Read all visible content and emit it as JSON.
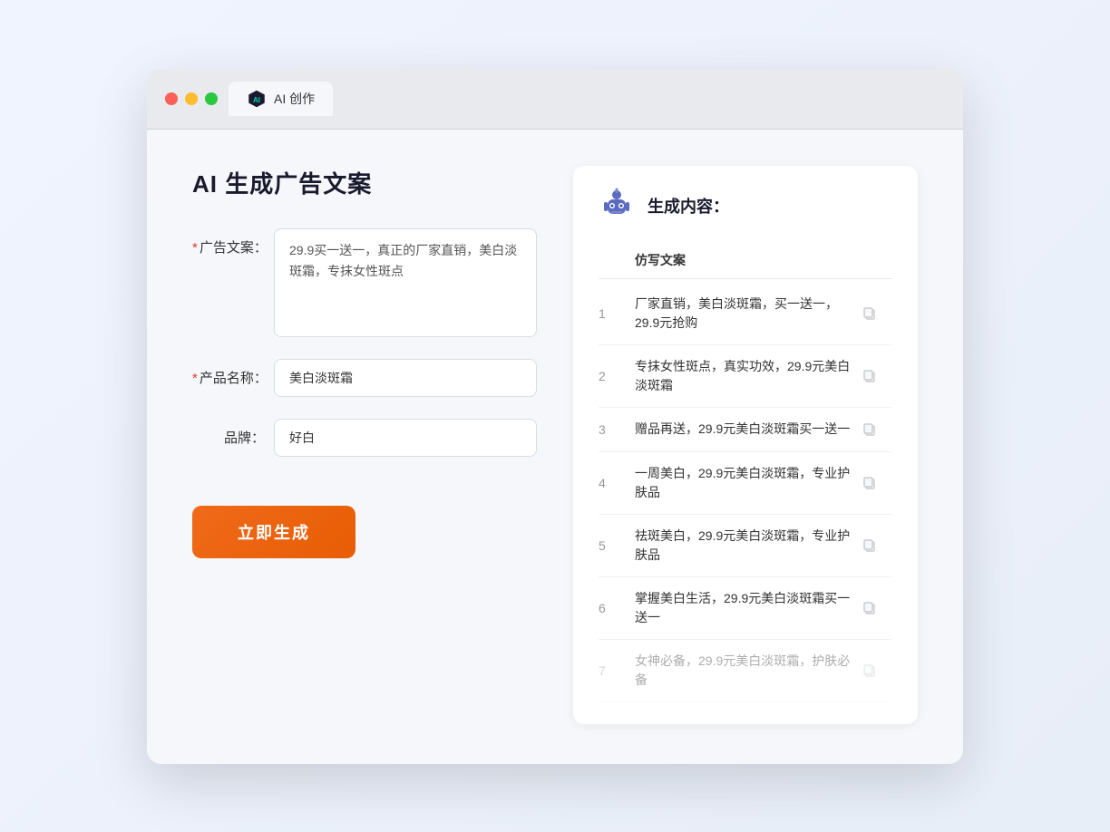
{
  "window": {
    "tab_label": "AI 创作"
  },
  "left_panel": {
    "title": "AI 生成广告文案",
    "form": {
      "ad_copy_label": "广告文案：",
      "ad_copy_required": "*",
      "ad_copy_value": "29.9买一送一，真正的厂家直销，美白淡斑霜，专抹女性斑点",
      "product_name_label": "产品名称：",
      "product_name_required": "*",
      "product_name_value": "美白淡斑霜",
      "brand_label": "品牌：",
      "brand_value": "好白"
    },
    "generate_btn": "立即生成"
  },
  "right_panel": {
    "title": "生成内容：",
    "table_header": "仿写文案",
    "results": [
      {
        "num": "1",
        "text": "厂家直销，美白淡斑霜，买一送一，29.9元抢购",
        "faded": false
      },
      {
        "num": "2",
        "text": "专抹女性斑点，真实功效，29.9元美白淡斑霜",
        "faded": false
      },
      {
        "num": "3",
        "text": "赠品再送，29.9元美白淡斑霜买一送一",
        "faded": false
      },
      {
        "num": "4",
        "text": "一周美白，29.9元美白淡斑霜，专业护肤品",
        "faded": false
      },
      {
        "num": "5",
        "text": "祛斑美白，29.9元美白淡斑霜，专业护肤品",
        "faded": false
      },
      {
        "num": "6",
        "text": "掌握美白生活，29.9元美白淡斑霜买一送一",
        "faded": false
      },
      {
        "num": "7",
        "text": "女神必备，29.9元美白淡斑霜，护肤必备",
        "faded": true
      }
    ]
  }
}
